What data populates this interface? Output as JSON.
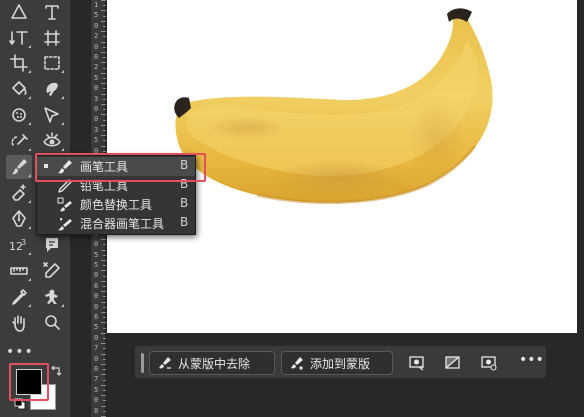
{
  "toolbar": {
    "more_glyph": "•••",
    "tools": [
      {
        "name": "move-tool",
        "icon": "triangle-icon"
      },
      {
        "name": "type-tool",
        "icon": "type-tool-icon"
      },
      {
        "name": "vertical-type-tool",
        "icon": "vertical-type-icon"
      },
      {
        "name": "frame-tool",
        "icon": "frame-icon"
      },
      {
        "name": "crop-tool",
        "icon": "crop-icon"
      },
      {
        "name": "marquee-tool",
        "icon": "rectangular-marquee-icon"
      },
      {
        "name": "paint-bucket-tool",
        "icon": "paint-bucket-icon"
      },
      {
        "name": "lasso-tool",
        "icon": "lasso-icon"
      },
      {
        "name": "sponge-tool",
        "icon": "sponge-icon"
      },
      {
        "name": "object-selection-tool",
        "icon": "object-selection-icon"
      },
      {
        "name": "spot-healing-tool",
        "icon": "spot-healing-icon"
      },
      {
        "name": "red-eye-tool",
        "icon": "red-eye-icon"
      },
      {
        "name": "brush-tool",
        "icon": "brush-icon"
      },
      {
        "name": "magic-eraser-tool",
        "icon": "magic-eraser-icon"
      },
      {
        "name": "pen-tool",
        "icon": "pen-icon"
      },
      {
        "name": "count-tool",
        "icon": "count-icon"
      },
      {
        "name": "note-tool",
        "icon": "note-icon"
      },
      {
        "name": "ruler-tool",
        "icon": "ruler-icon"
      },
      {
        "name": "color-sampler-tool",
        "icon": "color-sampler-icon"
      },
      {
        "name": "eyedropper-tool",
        "icon": "eyedropper-icon"
      },
      {
        "name": "puppet-tool",
        "icon": "puppet-icon"
      },
      {
        "name": "hand-tool",
        "icon": "hand-icon"
      },
      {
        "name": "zoom-tool",
        "icon": "zoom-icon"
      }
    ]
  },
  "colors": {
    "foreground": "#000000",
    "background": "#ffffff",
    "highlight": "#e0505e"
  },
  "ruler": {
    "labels": [
      "1",
      "5",
      "0",
      "2",
      "0",
      "0",
      "2",
      "5",
      "0",
      "3",
      "0",
      "0",
      "3",
      "5",
      "0",
      "4",
      "0",
      "0",
      "4",
      "5",
      "0",
      "5",
      "0",
      "0",
      "5",
      "5",
      "0",
      "6",
      "0",
      "0",
      "6",
      "5",
      "0",
      "7",
      "0",
      "0",
      "7",
      "5",
      "0",
      "8"
    ]
  },
  "flyout": {
    "items": [
      {
        "label": "画笔工具",
        "shortcut": "B",
        "icon": "brush-icon",
        "selected": true
      },
      {
        "label": "铅笔工具",
        "shortcut": "B",
        "icon": "pencil-icon",
        "selected": false
      },
      {
        "label": "颜色替换工具",
        "shortcut": "B",
        "icon": "color-replacement-icon",
        "selected": false
      },
      {
        "label": "混合器画笔工具",
        "shortcut": "B",
        "icon": "mixer-brush-icon",
        "selected": false
      }
    ]
  },
  "taskbar": {
    "subtract_label": "从蒙版中去除",
    "add_label": "添加到蒙版",
    "more_glyph": "•••"
  }
}
